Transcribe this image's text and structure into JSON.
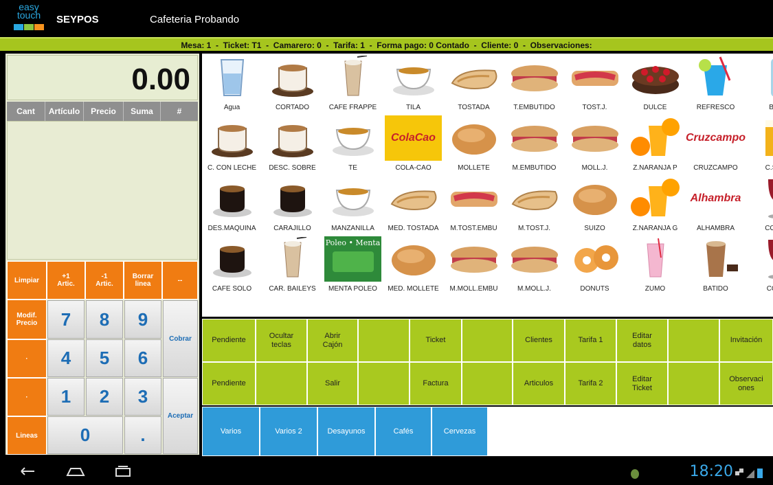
{
  "app": {
    "logo_top": "easy",
    "logo_bottom": "touch",
    "title": "SEYPOS",
    "shop": "Cafeteria Probando"
  },
  "info": {
    "text": "Mesa: 1  -  Ticket: T1  -  Camarero: 0  -  Tarifa: 1  -  Forma pago: 0 Contado  -  Cliente: 0  -  Observaciones:"
  },
  "display": {
    "total": "0.00"
  },
  "columns": [
    "Cant",
    "Artículo",
    "Precio",
    "Suma",
    "#"
  ],
  "keypad": {
    "limpiar": "Limpiar",
    "plus": "+1\nArtic.",
    "minus": "-1\nArtic.",
    "borrar": "Borrar\nlinea",
    "dash": "--",
    "modif": "Modif.\nPrecio",
    "dot1": "·",
    "dot2": "·",
    "lineas": "Lineas",
    "d7": "7",
    "d8": "8",
    "d9": "9",
    "d4": "4",
    "d5": "5",
    "d6": "6",
    "d1": "1",
    "d2": "2",
    "d3": "3",
    "d0": "0",
    "point": ".",
    "cobrar": "Cobrar",
    "aceptar": "Aceptar"
  },
  "products": [
    {
      "name": "Agua",
      "icon": "water-glass"
    },
    {
      "name": "CORTADO",
      "icon": "coffee-cup"
    },
    {
      "name": "CAFE FRAPPE",
      "icon": "frappe-glass"
    },
    {
      "name": "TILA",
      "icon": "tea-cup"
    },
    {
      "name": "TOSTADA",
      "icon": "toast"
    },
    {
      "name": "T.EMBUTIDO",
      "icon": "sandwich"
    },
    {
      "name": "TOST.J.",
      "icon": "ham-toast"
    },
    {
      "name": "DULCE",
      "icon": "cake"
    },
    {
      "name": "REFRESCO",
      "icon": "soda-glass"
    },
    {
      "name": "BOT",
      "icon": "bottle"
    },
    {
      "name": "C. CON LECHE",
      "icon": "coffee-cup"
    },
    {
      "name": "DESC. SOBRE",
      "icon": "coffee-cup"
    },
    {
      "name": "TE",
      "icon": "tea-cup"
    },
    {
      "name": "COLA-CAO",
      "icon": "colacao"
    },
    {
      "name": "MOLLETE",
      "icon": "bread"
    },
    {
      "name": "M.EMBUTIDO",
      "icon": "sandwich"
    },
    {
      "name": "MOLL.J.",
      "icon": "sandwich"
    },
    {
      "name": "Z.NARANJA P",
      "icon": "orange-juice"
    },
    {
      "name": "CRUZCAMPO",
      "icon": "beer-logo"
    },
    {
      "name": "C.S.AL",
      "icon": "beer-glass"
    },
    {
      "name": "DES.MAQUINA",
      "icon": "espresso"
    },
    {
      "name": "CARAJILLO",
      "icon": "espresso"
    },
    {
      "name": "MANZANILLA",
      "icon": "tea-cup"
    },
    {
      "name": "MED. TOSTADA",
      "icon": "toast"
    },
    {
      "name": "M.TOST.EMBU",
      "icon": "ham-toast"
    },
    {
      "name": "M.TOST.J.",
      "icon": "toast"
    },
    {
      "name": "SUIZO",
      "icon": "bread"
    },
    {
      "name": "Z.NARANJA G",
      "icon": "orange-juice"
    },
    {
      "name": "ALHAMBRA",
      "icon": "beer-logo"
    },
    {
      "name": "COPA I",
      "icon": "wine-glass"
    },
    {
      "name": "CAFE SOLO",
      "icon": "espresso"
    },
    {
      "name": "CAR. BAILEYS",
      "icon": "frappe-glass"
    },
    {
      "name": "MENTA POLEO",
      "icon": "tea-box"
    },
    {
      "name": "MED. MOLLETE",
      "icon": "bread"
    },
    {
      "name": "M.MOLL.EMBU",
      "icon": "sandwich"
    },
    {
      "name": "M.MOLL.J.",
      "icon": "sandwich"
    },
    {
      "name": "DONUTS",
      "icon": "donut"
    },
    {
      "name": "ZUMO",
      "icon": "juice-glass"
    },
    {
      "name": "BATIDO",
      "icon": "shake-glass"
    },
    {
      "name": "COPA",
      "icon": "wine-glass"
    }
  ],
  "product_art": {
    "colacao": "ColaCao",
    "cruzcampo": "Cruzcampo",
    "alhambra": "Alhambra",
    "poleo": "Poleo • Menta"
  },
  "functions": {
    "row1": [
      "Pendiente",
      "Ocultar\nteclas",
      "Abrir\nCajón",
      "",
      "Ticket",
      "",
      "Clientes",
      "Tarifa 1",
      "Editar\ndatos",
      "",
      "Invitación"
    ],
    "row2": [
      "Pendiente",
      "",
      "Salir",
      "",
      "Factura",
      "",
      "Articulos",
      "Tarifa 2",
      "Editar\nTicket",
      "",
      "Observaci\nones"
    ]
  },
  "categories": [
    "Varios",
    "Varios 2",
    "Desayunos",
    "Cafés",
    "Cervezas"
  ],
  "status": {
    "time": "18:20"
  },
  "colors": {
    "green": "#a9c91f",
    "orange": "#f07c12",
    "blue": "#2f9bd9",
    "clock": "#3aa8e8"
  }
}
